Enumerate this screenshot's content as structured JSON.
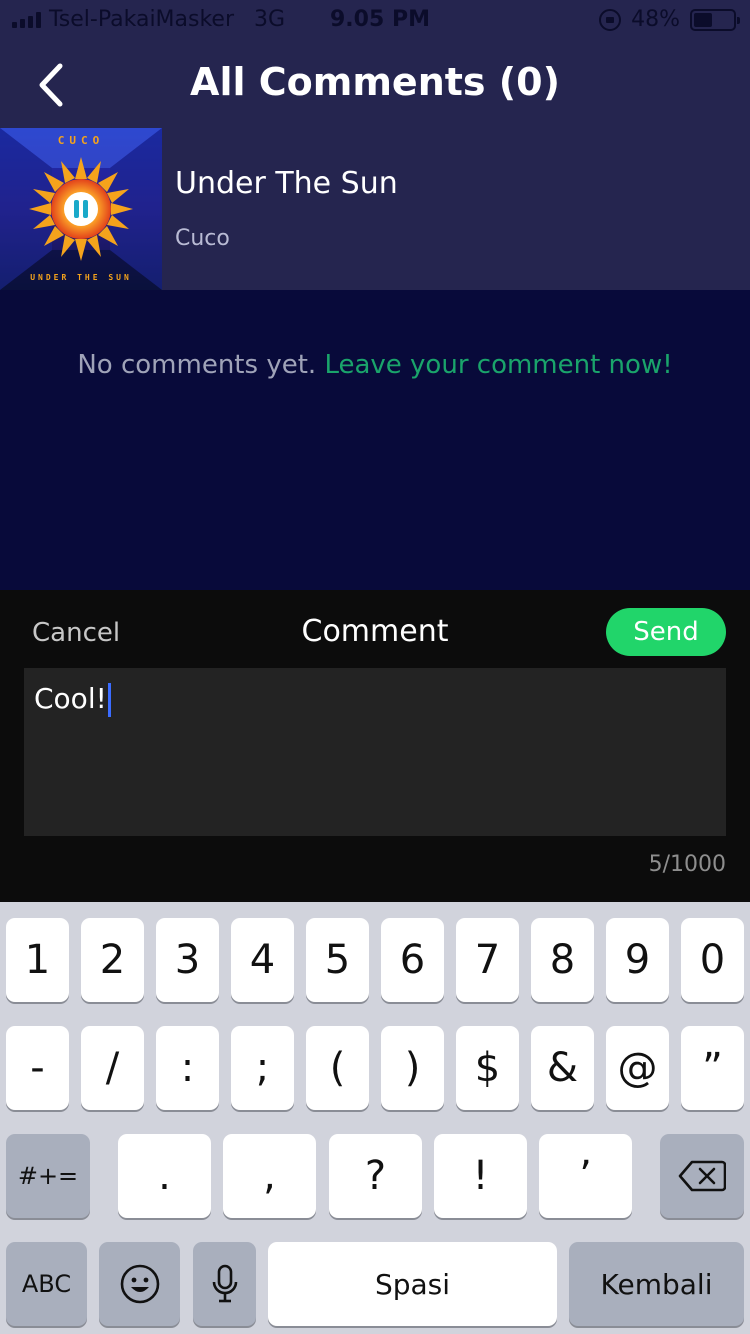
{
  "status_bar": {
    "carrier": "Tsel-PakaiMasker",
    "network": "3G",
    "time": "9.05 PM",
    "battery_percent": "48%",
    "battery_level": 0.48
  },
  "header": {
    "title": "All Comments (0)"
  },
  "song": {
    "title": "Under The Sun",
    "artist": "Cuco",
    "art_top_text": "CUCO",
    "art_bottom_text": "UNDER THE SUN"
  },
  "empty_state": {
    "text": "No comments yet.",
    "link": "Leave your comment now!"
  },
  "comment_panel": {
    "cancel_label": "Cancel",
    "title": "Comment",
    "send_label": "Send",
    "input_value": "Cool!",
    "char_count": "5/1000"
  },
  "keyboard": {
    "row1": [
      "1",
      "2",
      "3",
      "4",
      "5",
      "6",
      "7",
      "8",
      "9",
      "0"
    ],
    "row2": [
      "-",
      "/",
      ":",
      ";",
      "(",
      ")",
      "$",
      "&",
      "@",
      "”"
    ],
    "row3": {
      "mode": "#+=",
      "keys": [
        ".",
        ",",
        "?",
        "!",
        "’"
      ]
    },
    "row4": {
      "abc": "ABC",
      "space": "Spasi",
      "return": "Kembali"
    }
  },
  "colors": {
    "header_bg": "#25254f",
    "page_bg": "#080a3a",
    "accent_green": "#21d56a",
    "link_green": "#1aa46b"
  }
}
